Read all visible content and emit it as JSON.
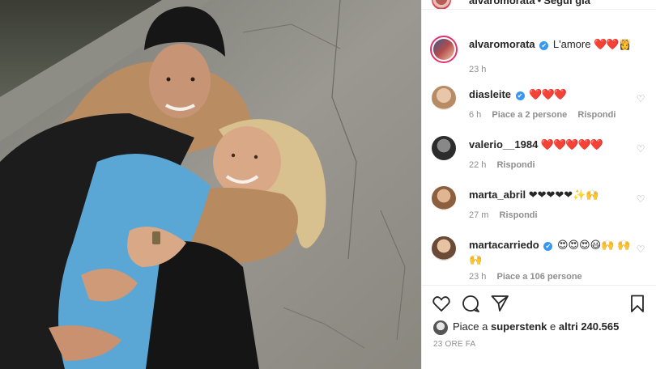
{
  "post": {
    "photo_label": "photo-of-couple"
  },
  "header": {
    "username": "alvaromorata",
    "separator": "•",
    "follow_label": "Segui già"
  },
  "caption": {
    "username": "alvaromorata",
    "verified": "✔",
    "text": "L'amore",
    "emoji": "❤️❤️👸",
    "time": "23 h"
  },
  "comments": [
    {
      "username": "diasleite",
      "verified": "✔",
      "text": "❤️❤️❤️",
      "time": "6 h",
      "likes": "Piace a 2 persone",
      "reply": "Rispondi"
    },
    {
      "username": "valerio__1984",
      "text": "❤️❤️❤️❤️❤️",
      "time": "22 h",
      "reply": "Rispondi"
    },
    {
      "username": "marta_abril",
      "text": "❤❤❤❤❤✨🙌",
      "time": "27 m",
      "reply": "Rispondi"
    },
    {
      "username": "martacarriedo",
      "verified": "✔",
      "text": "😍😍😍😃🙌 🙌🙌",
      "time": "23 h",
      "likes": "Piace a 106 persone"
    }
  ],
  "likes": {
    "prefix": "Piace a",
    "user": "superstenk",
    "connector": "e",
    "others": "altri 240.565"
  },
  "date": "23 ORE FA",
  "colors": {
    "heart": "#ed4956",
    "verified": "#3897f0",
    "muted": "#8e8e8e",
    "text": "#262626"
  },
  "icons": [
    "heart-icon",
    "comment-icon",
    "share-icon",
    "bookmark-icon",
    "like-comment-icon"
  ]
}
